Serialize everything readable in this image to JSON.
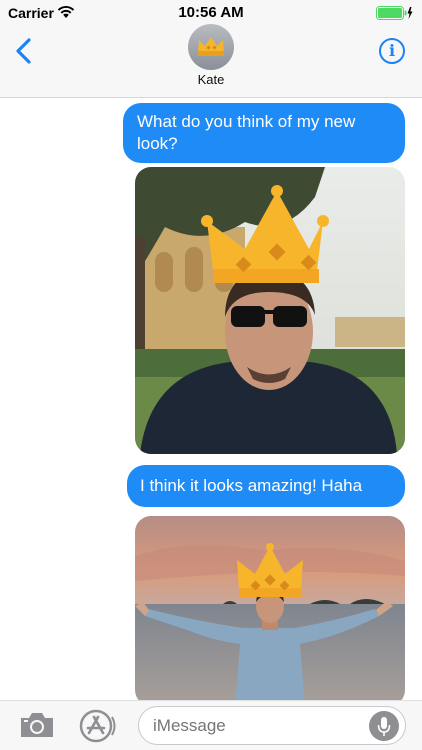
{
  "status_bar": {
    "carrier": "Carrier",
    "time": "10:56 AM"
  },
  "nav": {
    "contact_name": "Kate",
    "info_label": "i",
    "avatar_icon": "crown-icon",
    "back_icon": "chevron-left-icon"
  },
  "messages": [
    {
      "type": "text",
      "text": "What do you think of my new look?",
      "sender": "me"
    },
    {
      "type": "photo",
      "description_icon": "crown-sticker-photo"
    },
    {
      "type": "text",
      "text": "I think it looks amazing! Haha",
      "sender": "me"
    },
    {
      "type": "photo",
      "description_icon": "crown-sticker-photo"
    }
  ],
  "input_bar": {
    "placeholder": "iMessage",
    "camera_icon": "camera-icon",
    "appstore_icon": "app-store-icon",
    "mic_icon": "microphone-icon"
  },
  "colors": {
    "bubble_blue": "#1f8bf6",
    "accent": "#1a84f7",
    "battery_green": "#4cd964",
    "crown_gold": "#f7b52c"
  }
}
